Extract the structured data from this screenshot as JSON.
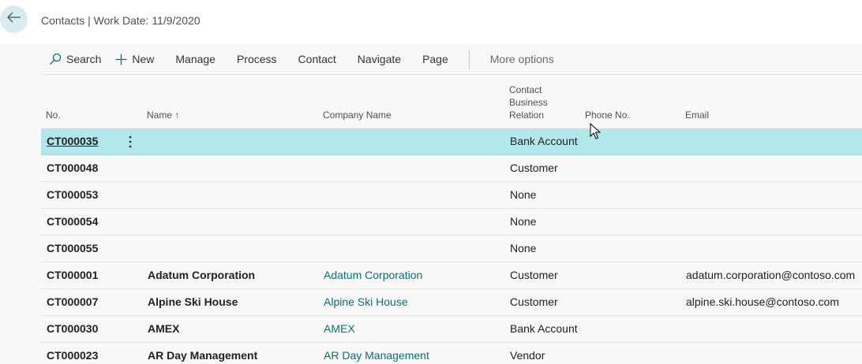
{
  "header": {
    "title": "Contacts | Work Date: 11/9/2020",
    "back_icon": "arrow-left-icon"
  },
  "actions": {
    "search": "Search",
    "new": "New",
    "manage": "Manage",
    "process": "Process",
    "contact": "Contact",
    "navigate": "Navigate",
    "page": "Page",
    "more_options": "More options"
  },
  "columns": {
    "no": "No.",
    "name": "Name",
    "name_sort_indicator": "↑",
    "company_name": "Company Name",
    "relation": [
      "Contact",
      "Business",
      "Relation"
    ],
    "phone": "Phone No.",
    "email": "Email"
  },
  "rows": [
    {
      "no": "CT000035",
      "name": "",
      "company": "",
      "relation": "Bank Account",
      "email": "",
      "selected": true
    },
    {
      "no": "CT000048",
      "name": "",
      "company": "",
      "relation": "Customer",
      "email": ""
    },
    {
      "no": "CT000053",
      "name": "",
      "company": "",
      "relation": "None",
      "email": ""
    },
    {
      "no": "CT000054",
      "name": "",
      "company": "",
      "relation": "None",
      "email": ""
    },
    {
      "no": "CT000055",
      "name": "",
      "company": "",
      "relation": "None",
      "email": ""
    },
    {
      "no": "CT000001",
      "name": "Adatum Corporation",
      "company": "Adatum Corporation",
      "relation": "Customer",
      "email": "adatum.corporation@contoso.com"
    },
    {
      "no": "CT000007",
      "name": "Alpine Ski House",
      "company": "Alpine Ski House",
      "relation": "Customer",
      "email": "alpine.ski.house@contoso.com"
    },
    {
      "no": "CT000030",
      "name": "AMEX",
      "company": "AMEX",
      "relation": "Bank Account",
      "email": ""
    },
    {
      "no": "CT000023",
      "name": "AR Day Management",
      "company": "AR Day Management",
      "relation": "Vendor",
      "email": ""
    }
  ],
  "colors": {
    "selected_row": "#b2e7ec",
    "link": "#00737a",
    "back_button": "#d6ecef"
  }
}
